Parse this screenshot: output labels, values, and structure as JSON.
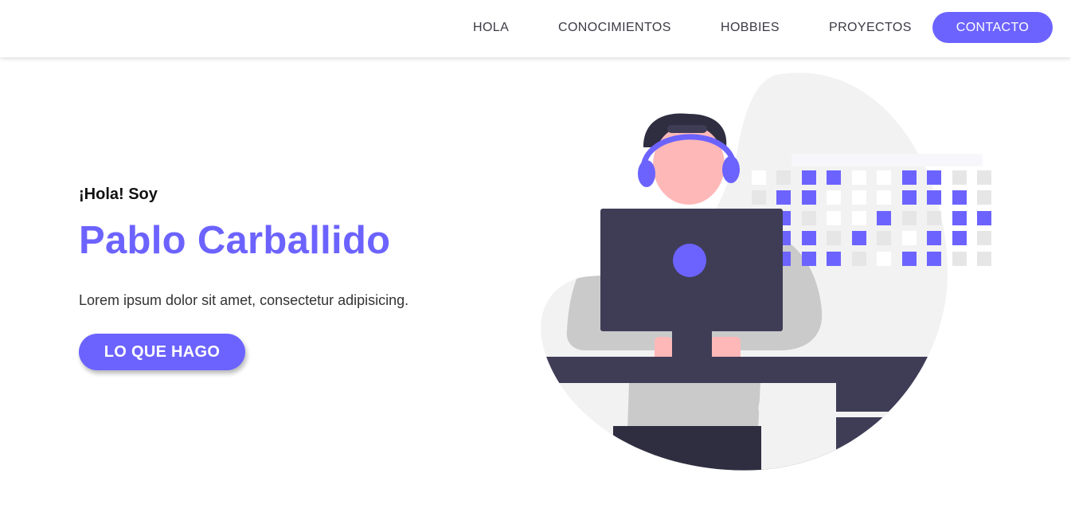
{
  "nav": {
    "items": [
      {
        "label": "HOLA"
      },
      {
        "label": "CONOCIMIENTOS"
      },
      {
        "label": "HOBBIES"
      },
      {
        "label": "PROYECTOS"
      }
    ],
    "cta_label": "CONTACTO"
  },
  "hero": {
    "greeting": "¡Hola! Soy",
    "name": "Pablo Carballido",
    "description": "Lorem ipsum dolor sit amet, consectetur adipisicing.",
    "button_label": "LO QUE HAGO"
  },
  "illustration": {
    "label": "Person with headphones working at computer illustration"
  },
  "colors": {
    "accent": "#6c63ff",
    "dark": "#3f3d56",
    "light_gray": "#f2f2f2",
    "mid_gray": "#cacaca",
    "skin": "#ffb8b8"
  }
}
